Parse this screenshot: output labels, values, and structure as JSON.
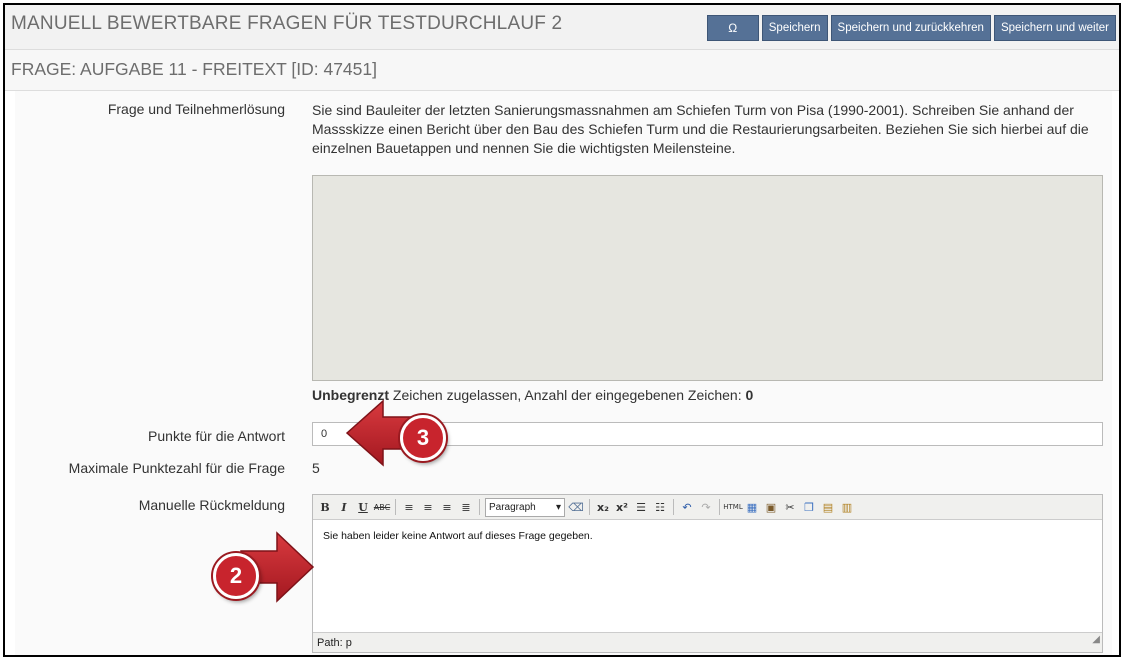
{
  "header": {
    "title": "MANUELL BEWERTBARE FRAGEN FÜR TESTDURCHLAUF 2",
    "buttons": {
      "omega": "Ω",
      "save": "Speichern",
      "save_return": "Speichern und zurückkehren",
      "save_next": "Speichern und weiter"
    }
  },
  "subheader": {
    "title": "FRAGE: AUFGABE 11 - FREITEXT [ID: 47451]"
  },
  "form": {
    "question_label": "Frage und Teilnehmerlösung",
    "question_text": "Sie sind Bauleiter der letzten Sanierungsmassnahmen am Schiefen Turm von Pisa (1990-2001). Schreiben Sie anhand der Massskizze einen Bericht über den Bau des Schiefen Turm und die Restaurierungsarbeiten. Beziehen Sie sich hierbei auf die einzelnen Bauetappen und nennen Sie die wichtigsten Meilensteine.",
    "char_info_bold": "Unbegrenzt",
    "char_info_text": " Zeichen zugelassen, Anzahl der eingegebenen Zeichen: ",
    "char_count": "0",
    "points_label": "Punkte für die Antwort",
    "points_value": "0",
    "max_points_label": "Maximale Punktezahl für die Frage",
    "max_points_value": "5",
    "feedback_label": "Manuelle Rückmeldung",
    "feedback_text": "Sie haben leider keine Antwort auf dieses Frage gegeben.",
    "editor_format": "Paragraph",
    "editor_path": "Path: p"
  },
  "callouts": {
    "badge_3": "3",
    "badge_2": "2"
  },
  "colors": {
    "button_bg": "#557196",
    "callout_red": "#c8242d"
  }
}
